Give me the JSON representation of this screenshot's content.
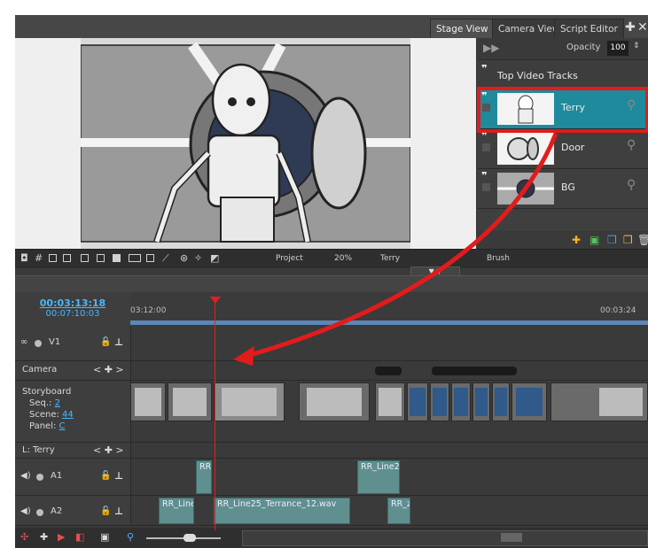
{
  "tabs": [
    {
      "label": "Stage View",
      "active": true
    },
    {
      "label": "Camera View",
      "active": false
    },
    {
      "label": "Script Editor",
      "active": false
    }
  ],
  "layers_panel": {
    "opacity_label": "Opacity",
    "opacity_value": "100",
    "group_label": "Top Video Tracks",
    "layers": [
      {
        "name": "Terry",
        "selected": true
      },
      {
        "name": "Door",
        "selected": false
      },
      {
        "name": "BG",
        "selected": false
      }
    ]
  },
  "stage_toolbar": {
    "project": "Project",
    "zoom": "20%",
    "layer": "Terry",
    "tool": "Brush"
  },
  "timeline": {
    "timecode_current": "00:03:13:18",
    "timecode_total": "00:07:10:03",
    "ruler_start": "03:12:00",
    "ruler_end": "00:03:24",
    "tracks": {
      "v1": "V1",
      "camera": "Camera",
      "storyboard": "Storyboard",
      "seq_label": "Seq.:",
      "seq_value": "2",
      "scene_label": "Scene:",
      "scene_value": "44",
      "panel_label": "Panel:",
      "panel_value": "C",
      "layer_track": "L: Terry",
      "a1": "A1",
      "a2": "A2"
    },
    "audio_clips": {
      "a1": [
        "RR_",
        "RR_Line2"
      ],
      "a2": [
        "RR_Line",
        "RR_Line25_Terrance_12.wav",
        "RR_z"
      ]
    }
  },
  "colors": {
    "accent": "#1f8a9c",
    "timecode": "#47b8ff",
    "playhead": "#e02020",
    "annotation": "#e31b1b"
  }
}
